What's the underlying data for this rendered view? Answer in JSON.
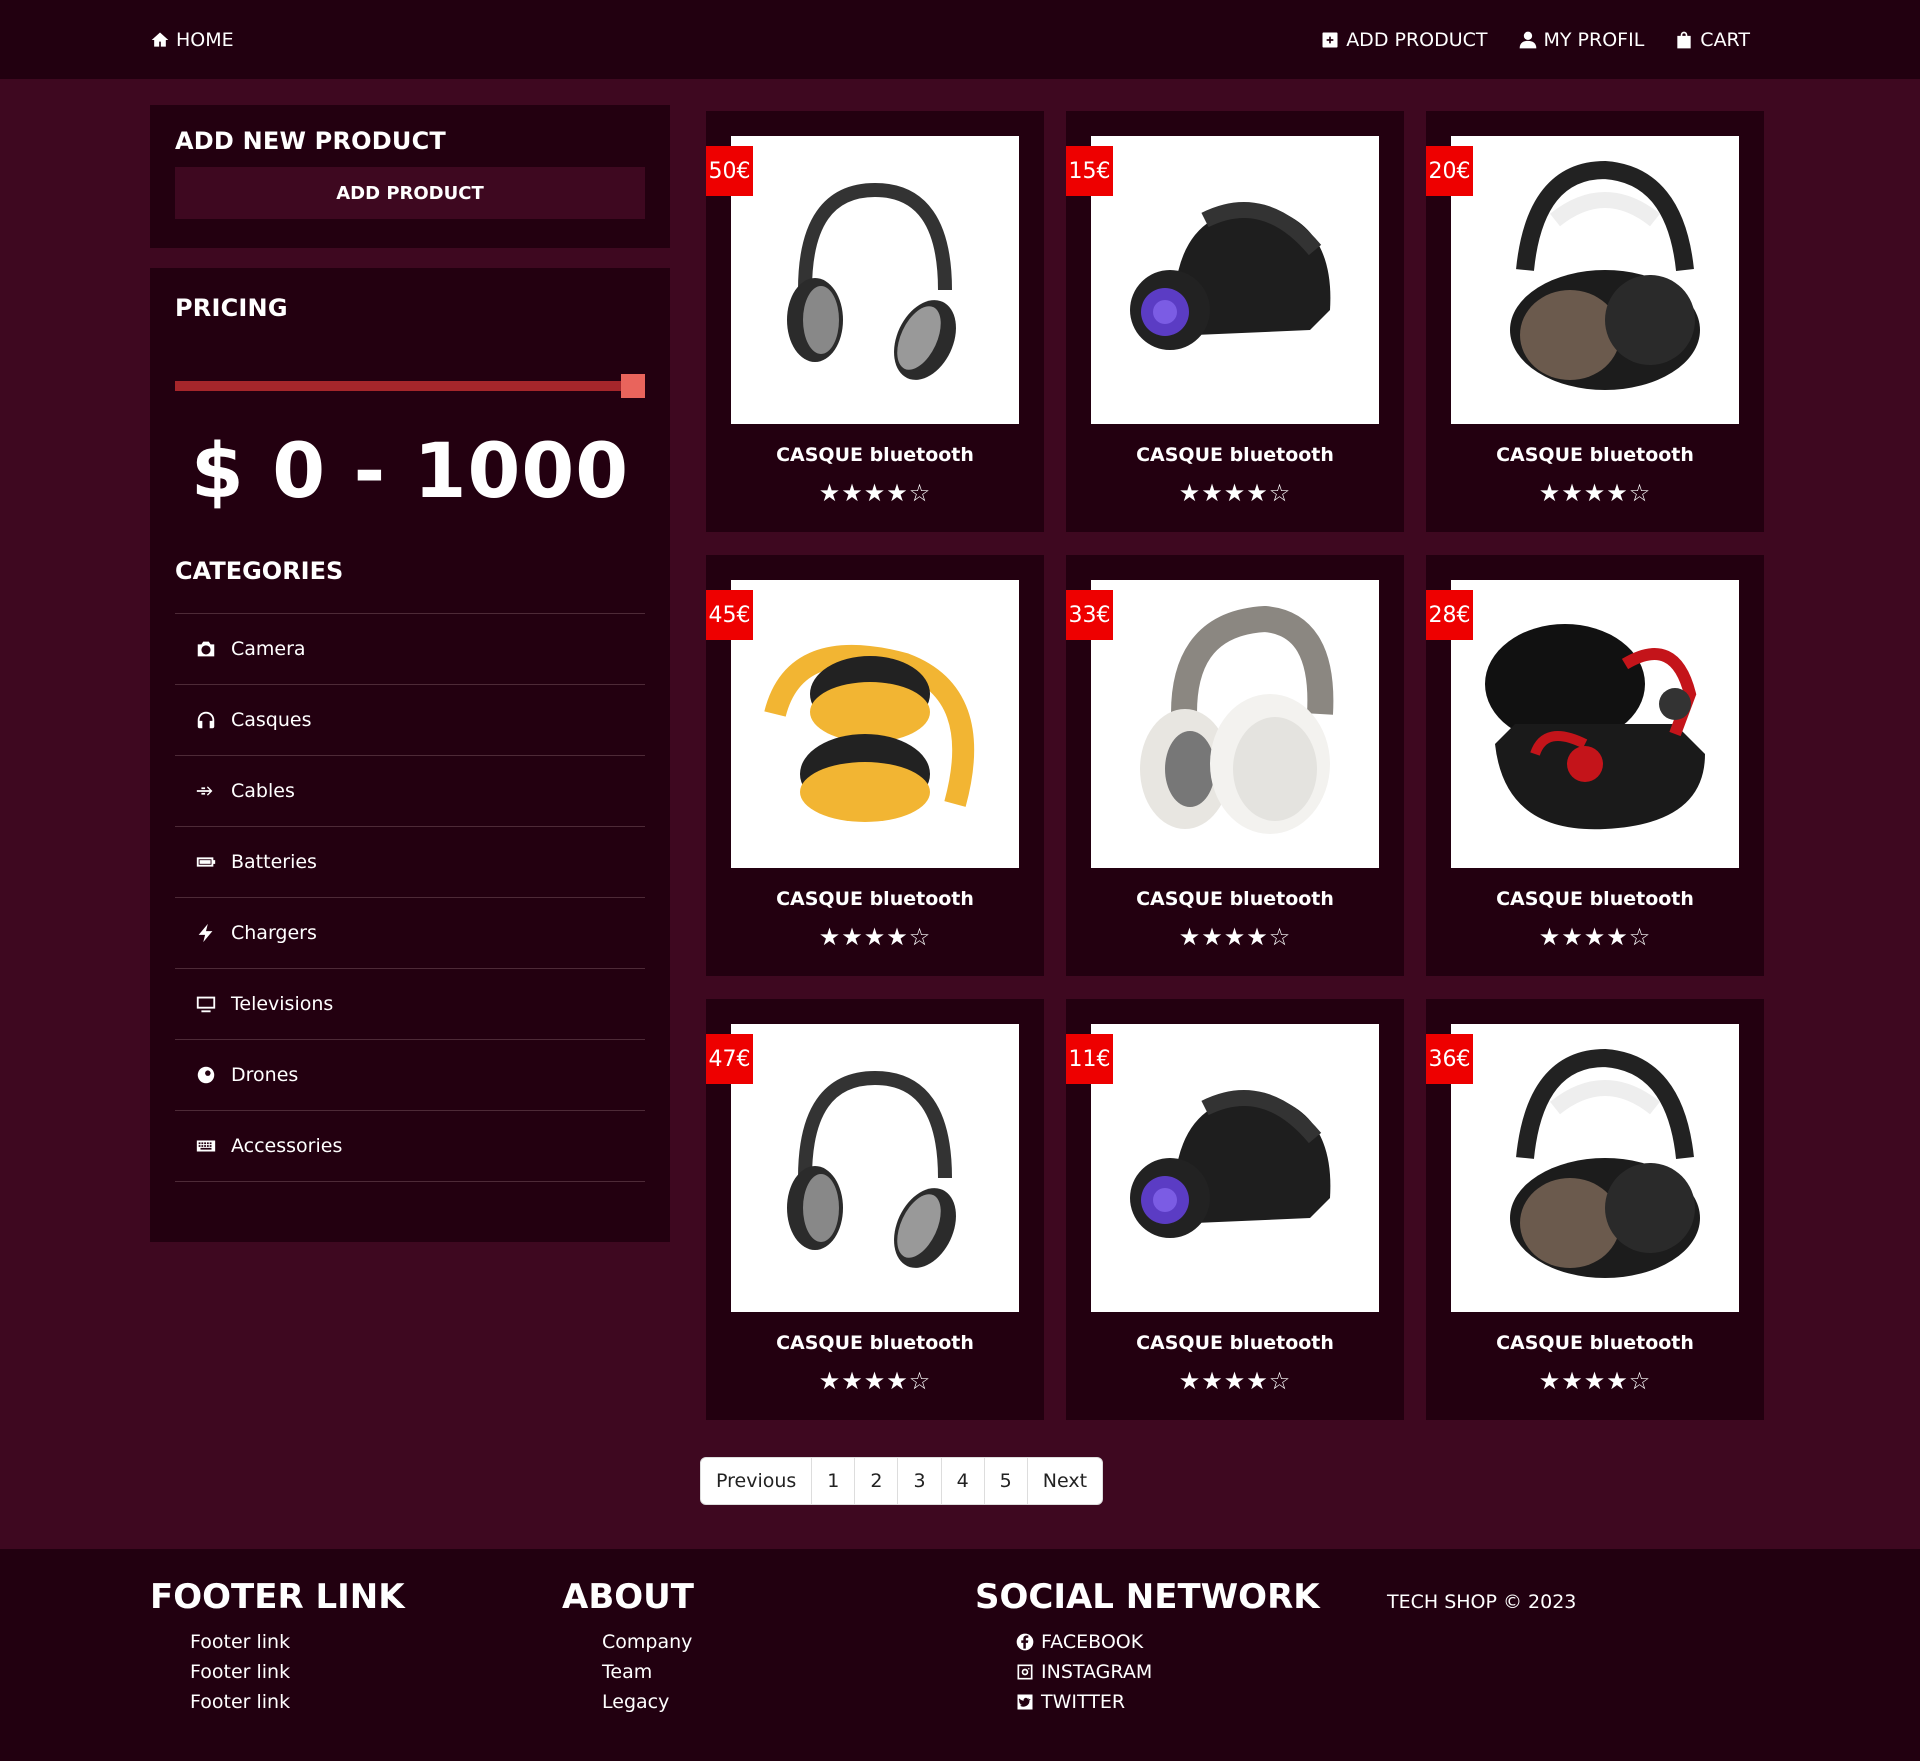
{
  "nav": {
    "home": "HOME",
    "add_product": "ADD PRODUCT",
    "profile": "MY PROFIL",
    "cart": "CART"
  },
  "add_box": {
    "title": "ADD NEW PRODUCT",
    "button": "ADD PRODUCT"
  },
  "pricing": {
    "title": "PRICING",
    "range": "$ 0 - 1000",
    "slider_value_fraction": 1.0
  },
  "categories": {
    "title": "CATEGORIES",
    "items": [
      {
        "label": "Camera",
        "icon": "camera-icon"
      },
      {
        "label": "Casques",
        "icon": "headphones-icon"
      },
      {
        "label": "Cables",
        "icon": "usb-icon"
      },
      {
        "label": "Batteries",
        "icon": "battery-icon"
      },
      {
        "label": "Chargers",
        "icon": "bolt-icon"
      },
      {
        "label": "Televisions",
        "icon": "tv-icon"
      },
      {
        "label": "Drones",
        "icon": "drone-icon"
      },
      {
        "label": "Accessories",
        "icon": "keyboard-icon"
      }
    ]
  },
  "products": [
    {
      "price": "50€",
      "name": "CASQUE bluetooth",
      "stars": "★★★★☆",
      "rating": 4,
      "image": "black-silver-headphones"
    },
    {
      "price": "15€",
      "name": "CASQUE bluetooth",
      "stars": "★★★★☆",
      "rating": 4,
      "image": "black-led-headphones"
    },
    {
      "price": "20€",
      "name": "CASQUE bluetooth",
      "stars": "★★★★☆",
      "rating": 4,
      "image": "wood-headphones"
    },
    {
      "price": "45€",
      "name": "CASQUE bluetooth",
      "stars": "★★★★☆",
      "rating": 4,
      "image": "yellow-headphones"
    },
    {
      "price": "33€",
      "name": "CASQUE bluetooth",
      "stars": "★★★★☆",
      "rating": 4,
      "image": "white-headphones"
    },
    {
      "price": "28€",
      "name": "CASQUE bluetooth",
      "stars": "★★★★☆",
      "rating": 4,
      "image": "red-earbuds"
    },
    {
      "price": "47€",
      "name": "CASQUE bluetooth",
      "stars": "★★★★☆",
      "rating": 4,
      "image": "black-silver-headphones"
    },
    {
      "price": "11€",
      "name": "CASQUE bluetooth",
      "stars": "★★★★☆",
      "rating": 4,
      "image": "black-led-headphones"
    },
    {
      "price": "36€",
      "name": "CASQUE bluetooth",
      "stars": "★★★★☆",
      "rating": 4,
      "image": "wood-headphones"
    }
  ],
  "pagination": {
    "previous": "Previous",
    "pages": [
      "1",
      "2",
      "3",
      "4",
      "5"
    ],
    "next": "Next"
  },
  "footer": {
    "col1": {
      "heading": "FOOTER LINK",
      "links": [
        "Footer link",
        "Footer link",
        "Footer link"
      ]
    },
    "col2": {
      "heading": "ABOUT",
      "links": [
        "Company",
        "Team",
        "Legacy"
      ]
    },
    "col3": {
      "heading": "SOCIAL NETWORK",
      "links": [
        "FACEBOOK",
        "INSTAGRAM",
        "TWITTER"
      ]
    },
    "copyright": "TECH SHOP © 2023"
  },
  "colors": {
    "background": "#3e0820",
    "panel": "#230010",
    "price_badge": "#ee0000",
    "slider_track": "#a5262b",
    "slider_thumb": "#e9645c"
  }
}
